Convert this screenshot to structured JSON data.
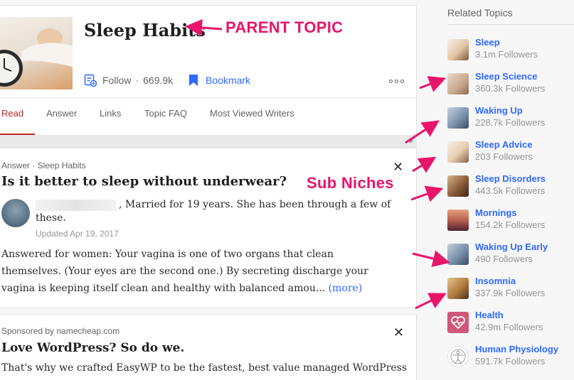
{
  "header": {
    "title": "Sleep Habits",
    "follow_label": "Follow",
    "follow_count": "669.9k",
    "bookmark_label": "Bookmark"
  },
  "tabs": [
    "Read",
    "Answer",
    "Links",
    "Topic FAQ",
    "Most Viewed Writers"
  ],
  "answer": {
    "meta": "Answer · Sleep Habits",
    "question": "Is it better to sleep without underwear?",
    "credential": ", Married for 19 years. She has been through a few of these.",
    "updated": "Updated Apr 19, 2017",
    "body": "Answered for women: Your vagina is one of two organs that clean themselves. (Your eyes are the second one.) By secreting discharge your vagina is keeping itself clean and healthy with balanced amou...",
    "more": "(more)"
  },
  "sponsored": {
    "meta": "Sponsored by namecheap.com",
    "title": "Love WordPress? So do we.",
    "body": "That's why we crafted EasyWP to be the fastest, best value managed WordPress"
  },
  "sidebar": {
    "title": "Related Topics",
    "items": [
      {
        "name": "Sleep",
        "followers": "3.1m Followers"
      },
      {
        "name": "Sleep Science",
        "followers": "360.3k Followers"
      },
      {
        "name": "Waking Up",
        "followers": "228.7k Followers"
      },
      {
        "name": "Sleep Advice",
        "followers": "203 Followers"
      },
      {
        "name": "Sleep Disorders",
        "followers": "443.5k Followers"
      },
      {
        "name": "Mornings",
        "followers": "154.2k Followers"
      },
      {
        "name": "Waking Up Early",
        "followers": "490 Followers"
      },
      {
        "name": "Insomnia",
        "followers": "337.9k Followers"
      },
      {
        "name": "Health",
        "followers": "42.9m Followers"
      },
      {
        "name": "Human Physiology",
        "followers": "591.7k Followers"
      }
    ]
  },
  "annotations": {
    "parent": "PARENT TOPIC",
    "sub": "Sub Niches"
  },
  "colors": {
    "accent_red": "#b92b27",
    "link_blue": "#2e69ff",
    "annotation_pink": "#e8156a"
  }
}
